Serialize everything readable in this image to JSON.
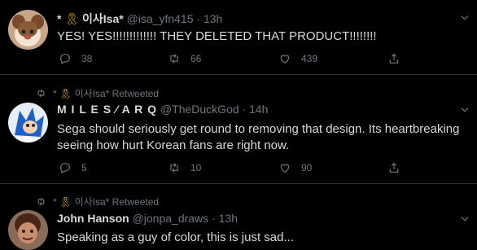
{
  "tweets": [
    {
      "author_prefix": "* ",
      "author_ribbon": "🎗",
      "author_name": "이사Isa*",
      "handle": "@isa_yfn415",
      "time": "13h",
      "text": "YES! YES!!!!!!!!!!!!! THEY DELETED THAT PRODUCT!!!!!!!!",
      "replies": "38",
      "retweets": "66",
      "likes": "439"
    },
    {
      "retweeted_by_prefix": "* ",
      "retweeted_by_ribbon": "🎗",
      "retweeted_by": "이사Isa* Retweeted",
      "author_name": "M I L E S ⁄ A R Q",
      "handle": "@TheDuckGod",
      "time": "14h",
      "text": "Sega should seriously get round to removing that design. Its heartbreaking seeing how hurt Korean fans are right now.",
      "replies": "5",
      "retweets": "10",
      "likes": "90"
    },
    {
      "retweeted_by_prefix": "* ",
      "retweeted_by_ribbon": "🎗",
      "retweeted_by": "이사Isa* Retweeted",
      "author_name": "John Hanson",
      "handle": "@jonpa_draws",
      "time": "13h",
      "text": "Speaking as a guy of color, this is just sad..."
    }
  ]
}
